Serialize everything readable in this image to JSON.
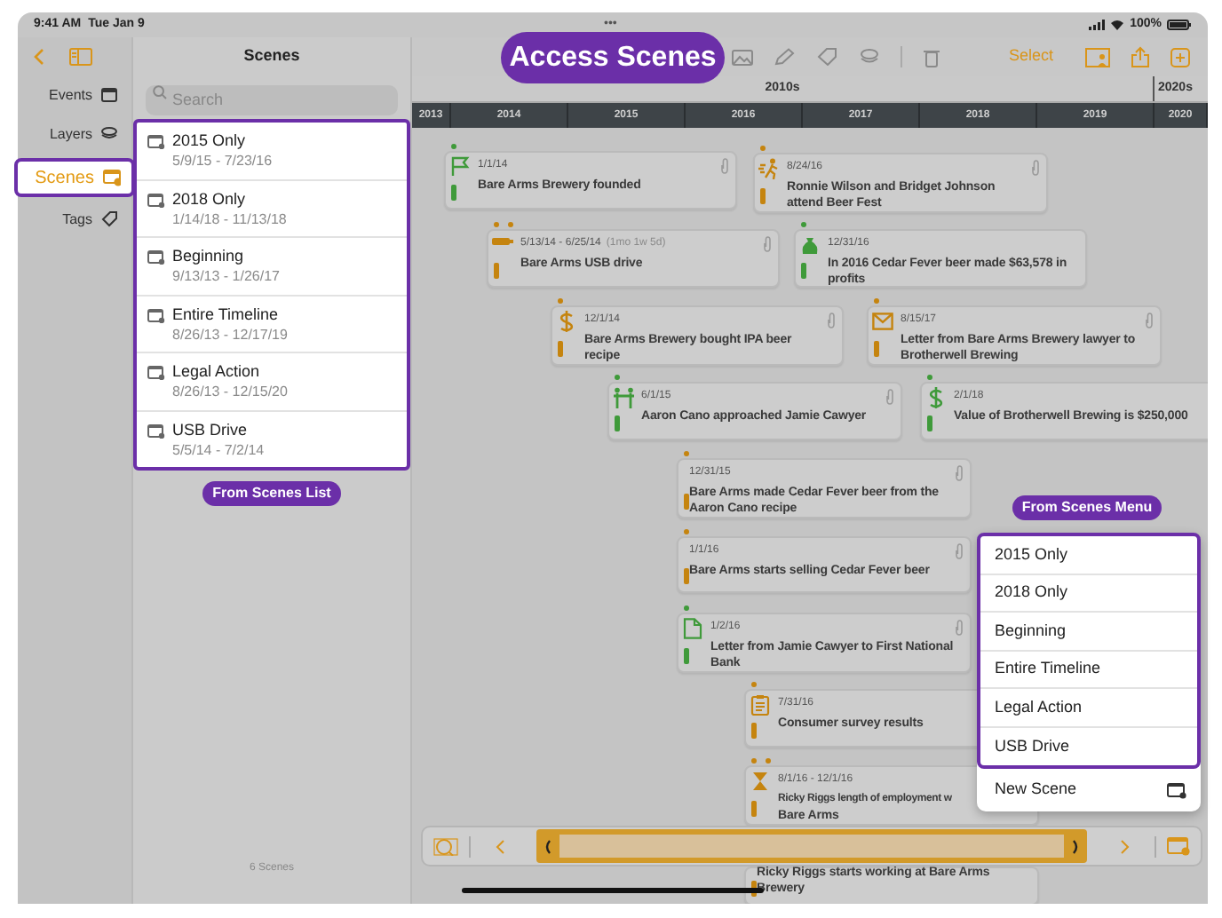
{
  "status_bar": {
    "time": "9:41 AM",
    "date": "Tue Jan 9",
    "battery": "100%",
    "multitask": "•••"
  },
  "callouts": [
    {
      "text": "Access Scenes"
    },
    {
      "text": "From Scenes List"
    },
    {
      "text": "From Scenes Menu"
    }
  ],
  "sidebar": {
    "items": [
      {
        "label": "Events",
        "selected": false
      },
      {
        "label": "Layers",
        "selected": false
      },
      {
        "label": "Scenes",
        "selected": true
      },
      {
        "label": "Tags",
        "selected": false
      }
    ]
  },
  "scenes_panel": {
    "title": "Scenes",
    "search": {
      "placeholder": "Search"
    },
    "footer": "6 Scenes",
    "scenes": [
      {
        "name": "2015 Only",
        "dates": "5/9/15 - 7/23/16"
      },
      {
        "name": "2018 Only",
        "dates": "1/14/18 - 11/13/18"
      },
      {
        "name": "Beginning",
        "dates": "9/13/13 - 1/26/17"
      },
      {
        "name": "Entire Timeline",
        "dates": "8/26/13 - 12/17/19"
      },
      {
        "name": "Legal Action",
        "dates": "8/26/13 - 12/15/20"
      },
      {
        "name": "USB Drive",
        "dates": "5/5/14 - 7/2/14"
      }
    ]
  },
  "toolbar": {
    "select": "Select"
  },
  "timeline": {
    "decades": [
      "2010s",
      "2020s"
    ],
    "years": [
      "2013",
      "2014",
      "2015",
      "2016",
      "2017",
      "2018",
      "2019",
      "2020"
    ],
    "events": [
      {
        "date": "1/1/14",
        "title": "Bare Arms Brewery founded",
        "color": "#3f9a3a",
        "kind": "point",
        "attachment": true
      },
      {
        "date": "8/24/16",
        "title": "Ronnie Wilson and Bridget Johnson attend Beer Fest",
        "color": "#c5840f",
        "kind": "point",
        "attachment": true
      },
      {
        "date": "5/13/14 - 6/25/14",
        "duration": "(1mo 1w 5d)",
        "title": "Bare Arms USB drive",
        "color": "#c5840f",
        "kind": "span",
        "attachment": true
      },
      {
        "date": "12/31/16",
        "title": "In 2016 Cedar Fever beer made $63,578 in profits",
        "color": "#3f9a3a",
        "kind": "point",
        "attachment": false
      },
      {
        "date": "12/1/14",
        "title": "Bare Arms Brewery bought IPA beer recipe",
        "color": "#c5840f",
        "kind": "point",
        "attachment": true
      },
      {
        "date": "8/15/17",
        "title": "Letter from Bare Arms Brewery lawyer to Brotherwell Brewing",
        "color": "#c5840f",
        "kind": "point",
        "attachment": true
      },
      {
        "date": "6/1/15",
        "title": "Aaron Cano approached Jamie Cawyer",
        "color": "#3f9a3a",
        "kind": "point",
        "attachment": true
      },
      {
        "date": "2/1/18",
        "title": "Value of Brotherwell Brewing is $250,000",
        "color": "#3f9a3a",
        "kind": "point",
        "attachment": false
      },
      {
        "date": "12/31/15",
        "title": "Bare Arms made Cedar Fever beer from the Aaron Cano recipe",
        "color": "#c5840f",
        "kind": "point",
        "attachment": true
      },
      {
        "date": "1/1/16",
        "title": "Bare Arms starts selling Cedar Fever beer",
        "color": "#c5840f",
        "kind": "point",
        "attachment": true
      },
      {
        "date": "1/2/16",
        "title": "Letter from Jamie Cawyer to First National Bank",
        "color": "#3f9a3a",
        "kind": "point",
        "attachment": true
      },
      {
        "date": "7/31/16",
        "title": "Consumer survey results",
        "color": "#c5840f",
        "kind": "point",
        "attachment": false
      },
      {
        "date": "8/1/16 - 12/1/16",
        "title": "Ricky Riggs length of employment w",
        "title_continued": "Bare Arms",
        "color": "#c5840f",
        "kind": "span",
        "attachment": false
      },
      {
        "title": "Ricky Riggs starts working at Bare Arms Brewery",
        "color": "#c5840f",
        "kind": "point",
        "attachment": false
      }
    ]
  },
  "scenes_menu": {
    "items": [
      "2015 Only",
      "2018 Only",
      "Beginning",
      "Entire Timeline",
      "Legal Action",
      "USB Drive"
    ],
    "new_scene": "New Scene"
  }
}
